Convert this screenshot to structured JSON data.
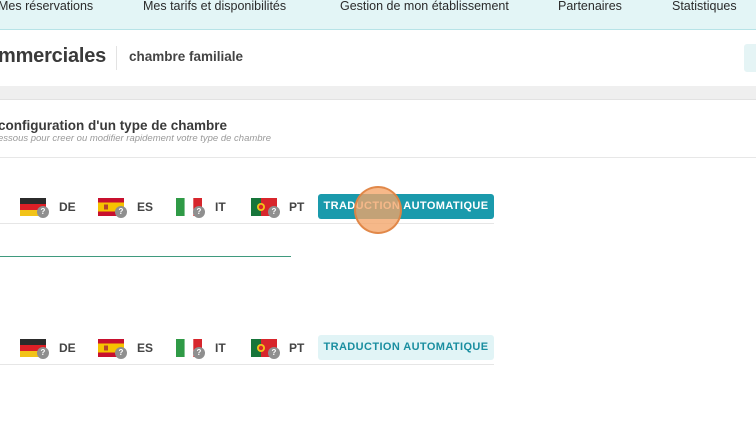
{
  "topnav": {
    "items": [
      {
        "label": "Mes réservations"
      },
      {
        "label": "Mes tarifs et disponibilités"
      },
      {
        "label": "Gestion de mon établissement"
      },
      {
        "label": "Partenaires"
      },
      {
        "label": "Statistiques"
      }
    ]
  },
  "header": {
    "title": "mmerciales",
    "subtitle": "chambre familiale"
  },
  "section": {
    "title": "configuration d'un type de chambre",
    "subtitle": "essous pour creer ou modifier rapidement votre type de chambre"
  },
  "languages": [
    {
      "code": "DE",
      "flag": "germany-flag",
      "status": "?"
    },
    {
      "code": "ES",
      "flag": "spain-flag",
      "status": "?"
    },
    {
      "code": "IT",
      "flag": "italy-flag",
      "status": "?"
    },
    {
      "code": "PT",
      "flag": "portugal-flag",
      "status": "?"
    }
  ],
  "auto_translate": {
    "label": "TRADUCTION AUTOMATIQUE"
  },
  "colors": {
    "accent": "#1a9aac",
    "accent_light": "#e1f4f6",
    "nav_bg": "#e3f5f6",
    "click_indicator": "#f3a468"
  }
}
